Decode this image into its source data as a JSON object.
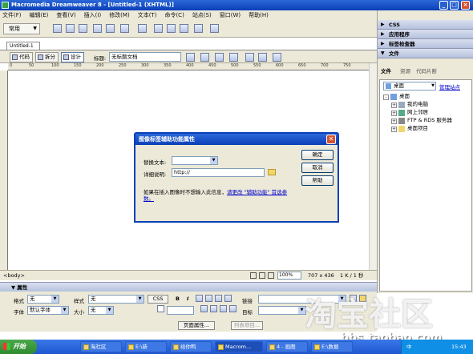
{
  "window": {
    "title": "Macromedia Dreamweaver 8 - [Untitled-1 (XHTML)]",
    "controls": [
      "_",
      "□",
      "×"
    ]
  },
  "menu": [
    "文件(F)",
    "编辑(E)",
    "查看(V)",
    "插入(I)",
    "修改(M)",
    "文本(T)",
    "命令(C)",
    "站点(S)",
    "窗口(W)",
    "帮助(H)"
  ],
  "insert_bar": {
    "category": "常用"
  },
  "document": {
    "tab": "Untitled-1",
    "view_buttons": [
      "代码",
      "拆分",
      "设计"
    ],
    "title_label": "标题:",
    "title_value": "无标题文档",
    "ruler_ticks": [
      "0",
      "50",
      "100",
      "150",
      "200",
      "250",
      "300",
      "350",
      "400",
      "450",
      "500",
      "550",
      "600",
      "650",
      "700",
      "750"
    ]
  },
  "status_bar": {
    "tag": "<body>",
    "zoom": "100%",
    "size": "707 x 436",
    "weight": "1 K / 1 秒"
  },
  "properties": {
    "header": "▼ 属性",
    "format_label": "格式",
    "format_value": "无",
    "style_label": "样式",
    "style_value": "无",
    "css_button": "CSS",
    "bold": "B",
    "italic": "I",
    "link_label": "链接",
    "font_label": "字体",
    "font_value": "默认字体",
    "size_label": "大小",
    "size_value": "无",
    "target_label": "目标",
    "page_props_button": "页面属性...",
    "list_item_button": "列表项目..."
  },
  "right_panel": {
    "panels": [
      "CSS",
      "应用程序",
      "标签检查器",
      "文件"
    ],
    "file_tabs": [
      "文件",
      "资源",
      "代码片断"
    ],
    "site_select": "桌面",
    "manage_sites": "管理站点",
    "tree": [
      "桌面",
      "我的电脑",
      "网上邻居",
      "FTP & RDS 服务器",
      "桌面项目"
    ]
  },
  "dialog": {
    "title": "图像标签辅助功能属性",
    "alt_label": "替换文本:",
    "longdesc_label": "详细说明:",
    "longdesc_value": "http://",
    "ok": "确定",
    "cancel": "取消",
    "help": "帮助",
    "note_prefix": "如果在插入图像时不想输入此信息，",
    "note_link": "请更改 \"辅助功能\" 首选参数。"
  },
  "taskbar": {
    "start": "开始",
    "tasks": [
      "淘社区",
      "E:\\新",
      "给你鸭",
      "Macrom...",
      "4 - 画图",
      "E:\\数据"
    ],
    "clock": "15:43",
    "ime": "中"
  },
  "watermark": {
    "text": "淘宝社区",
    "url": "bbs.taobao.com"
  }
}
